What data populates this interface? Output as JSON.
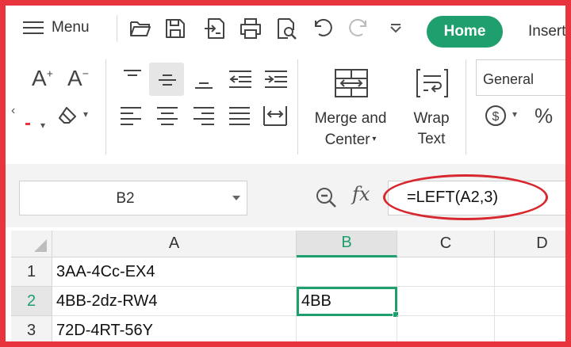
{
  "toolbar": {
    "menu_label": "Menu",
    "icons": [
      "hamburger-icon",
      "open-folder-icon",
      "save-icon",
      "export-icon",
      "print-icon",
      "print-preview-icon",
      "undo-icon",
      "redo-icon",
      "customize-chevron-icon"
    ]
  },
  "tabs": {
    "home_label": "Home",
    "insert_label": "Insert",
    "active_color": "#1f9e6e"
  },
  "ribbon": {
    "merge_label_line1": "Merge and",
    "merge_label_line2": "Center",
    "wrap_label_line1": "Wrap",
    "wrap_label_line2": "Text",
    "number_format": "General",
    "percent_symbol": "%"
  },
  "formula_bar": {
    "name_box": "B2",
    "fx_label": "fx",
    "formula": "=LEFT(A2,3)",
    "highlight_color": "#d8282f"
  },
  "sheet": {
    "columns": [
      "A",
      "B",
      "C",
      "D"
    ],
    "active_column": "B",
    "rows": [
      {
        "num": "1",
        "cells": [
          "3AA-4Cc-EX4",
          "",
          "",
          ""
        ]
      },
      {
        "num": "2",
        "cells": [
          "4BB-2dz-RW4",
          "4BB",
          "",
          ""
        ]
      },
      {
        "num": "3",
        "cells": [
          "72D-4RT-56Y",
          "",
          "",
          ""
        ]
      }
    ],
    "selected_cell": "B2",
    "frame_color": "#e8343d"
  }
}
